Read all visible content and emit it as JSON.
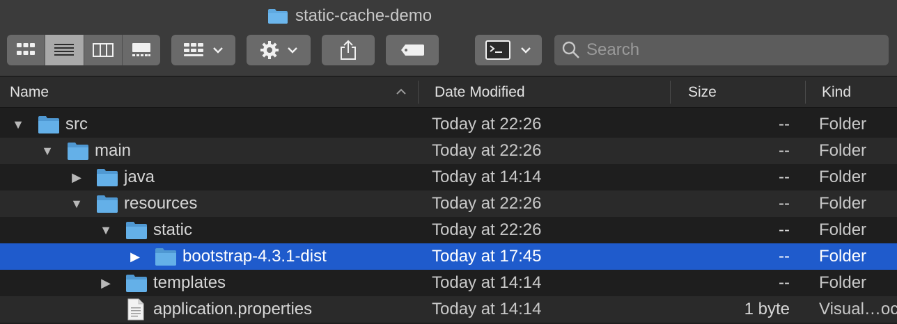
{
  "window": {
    "title": "static-cache-demo"
  },
  "toolbar": {
    "view_modes": [
      "icon-view",
      "list-view",
      "column-view",
      "gallery-view"
    ],
    "search_placeholder": "Search"
  },
  "columns": {
    "name": "Name",
    "date": "Date Modified",
    "size": "Size",
    "kind": "Kind"
  },
  "rows": [
    {
      "name": "src",
      "date": "Today at 22:26",
      "size": "--",
      "kind": "Folder",
      "expanded": true
    },
    {
      "name": "main",
      "date": "Today at 22:26",
      "size": "--",
      "kind": "Folder",
      "expanded": true
    },
    {
      "name": "java",
      "date": "Today at 14:14",
      "size": "--",
      "kind": "Folder",
      "expanded": false
    },
    {
      "name": "resources",
      "date": "Today at 22:26",
      "size": "--",
      "kind": "Folder",
      "expanded": true
    },
    {
      "name": "static",
      "date": "Today at 22:26",
      "size": "--",
      "kind": "Folder",
      "expanded": true
    },
    {
      "name": "bootstrap-4.3.1-dist",
      "date": "Today at 17:45",
      "size": "--",
      "kind": "Folder",
      "expanded": false,
      "selected": true
    },
    {
      "name": "templates",
      "date": "Today at 14:14",
      "size": "--",
      "kind": "Folder",
      "expanded": false
    },
    {
      "name": "application.properties",
      "date": "Today at 14:14",
      "size": "1 byte",
      "kind": "Visual…oc"
    }
  ],
  "colors": {
    "selection": "#1f5bcc",
    "folder": "#5fa9e0"
  }
}
